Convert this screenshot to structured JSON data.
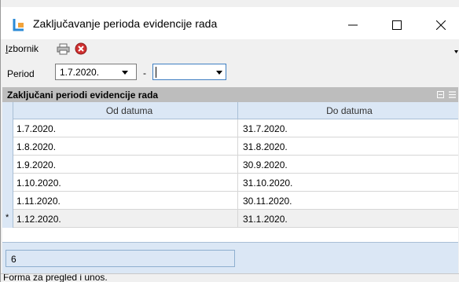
{
  "window": {
    "title": "Zaključavanje perioda evidencije rada"
  },
  "menu": {
    "label_underlined": "I",
    "label_rest": "zbornik"
  },
  "filter": {
    "label": "Period",
    "from_value": "1.7.2020.",
    "separator": "-",
    "to_value": ""
  },
  "panel": {
    "title": "Zaključani periodi evidencije rada"
  },
  "grid": {
    "columns": [
      "Od datuma",
      "Do datuma"
    ],
    "rows": [
      {
        "from": "1.7.2020.",
        "to": "31.7.2020."
      },
      {
        "from": "1.8.2020.",
        "to": "31.8.2020."
      },
      {
        "from": "1.9.2020.",
        "to": "30.9.2020."
      },
      {
        "from": "1.10.2020.",
        "to": "31.10.2020."
      },
      {
        "from": "1.11.2020.",
        "to": "30.11.2020."
      },
      {
        "from": "1.12.2020.",
        "to": "31.1.2020."
      }
    ],
    "new_row_marker": "*",
    "count": "6"
  },
  "status": {
    "text": "Forma za pregled i unos."
  },
  "colors": {
    "accent": "#3f7fc2",
    "grid_header": "#dbe7f5",
    "panel_header": "#bdbdbd",
    "stop_icon": "#d03030"
  },
  "icons": {
    "app": "lock-period-icon",
    "print": "printer-icon",
    "stop": "stop-icon",
    "minimize": "minimize-icon",
    "maximize": "maximize-icon",
    "close": "close-icon"
  }
}
